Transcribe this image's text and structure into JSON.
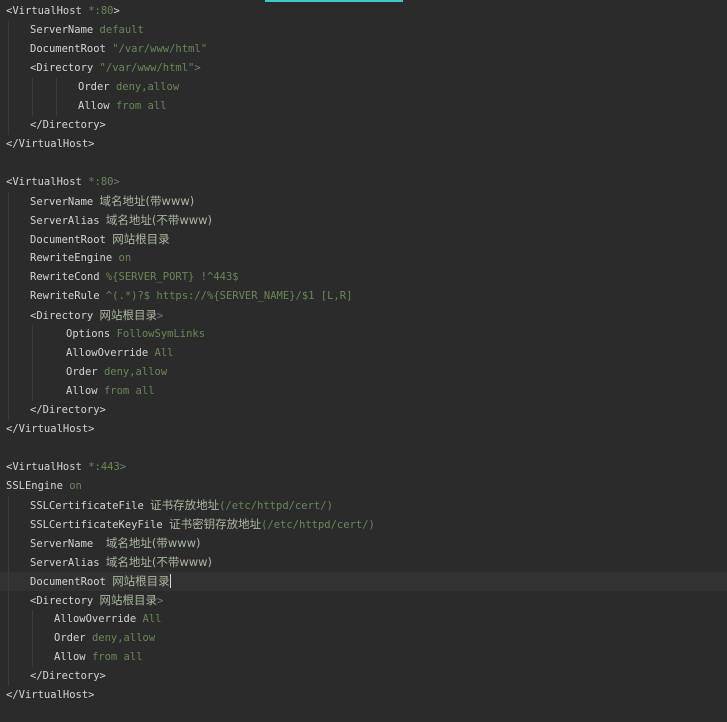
{
  "editor": {
    "lines": [
      {
        "indent": 0,
        "tokens": [
          {
            "t": "<VirtualHost ",
            "c": "k"
          },
          {
            "t": "*:80",
            "c": "v"
          },
          {
            "t": ">",
            "c": "k"
          }
        ]
      },
      {
        "indent": 1,
        "tokens": [
          {
            "t": "ServerName ",
            "c": "k"
          },
          {
            "t": "default",
            "c": "v"
          }
        ]
      },
      {
        "indent": 1,
        "tokens": [
          {
            "t": "DocumentRoot ",
            "c": "k"
          },
          {
            "t": "\"/var/www/html\"",
            "c": "v"
          }
        ]
      },
      {
        "indent": 1,
        "tokens": [
          {
            "t": "<Directory ",
            "c": "k"
          },
          {
            "t": "\"/var/www/html\"",
            "c": "v"
          },
          {
            "t": ">",
            "c": "p"
          }
        ]
      },
      {
        "indent": 3,
        "tokens": [
          {
            "t": "Order ",
            "c": "k"
          },
          {
            "t": "deny,allow",
            "c": "v"
          }
        ]
      },
      {
        "indent": 3,
        "tokens": [
          {
            "t": "Allow ",
            "c": "k"
          },
          {
            "t": "from all",
            "c": "v"
          }
        ]
      },
      {
        "indent": 1,
        "tokens": [
          {
            "t": "</Directory>",
            "c": "k"
          }
        ]
      },
      {
        "indent": 0,
        "tokens": [
          {
            "t": "</VirtualHost>",
            "c": "k"
          }
        ]
      },
      {
        "indent": 0,
        "tokens": []
      },
      {
        "indent": 0,
        "tokens": [
          {
            "t": "<VirtualHost ",
            "c": "k"
          },
          {
            "t": "*:80",
            "c": "v"
          },
          {
            "t": ">",
            "c": "p"
          }
        ]
      },
      {
        "indent": 1,
        "tokens": [
          {
            "t": "ServerName ",
            "c": "k"
          },
          {
            "t": "域名地址(带www)",
            "c": "cjk"
          }
        ]
      },
      {
        "indent": 1,
        "tokens": [
          {
            "t": "ServerAlias ",
            "c": "k"
          },
          {
            "t": "域名地址(不带www)",
            "c": "cjk"
          }
        ]
      },
      {
        "indent": 1,
        "tokens": [
          {
            "t": "DocumentRoot ",
            "c": "k"
          },
          {
            "t": "网站根目录",
            "c": "cjk"
          }
        ]
      },
      {
        "indent": 1,
        "tokens": [
          {
            "t": "RewriteEngine ",
            "c": "k"
          },
          {
            "t": "on",
            "c": "v"
          }
        ]
      },
      {
        "indent": 1,
        "tokens": [
          {
            "t": "RewriteCond ",
            "c": "k"
          },
          {
            "t": "%{SERVER_PORT} !^443$",
            "c": "v"
          }
        ]
      },
      {
        "indent": 1,
        "tokens": [
          {
            "t": "RewriteRule ",
            "c": "k"
          },
          {
            "t": "^(.*)?$ https://%{SERVER_NAME}/$1 [L,R]",
            "c": "v"
          }
        ]
      },
      {
        "indent": 1,
        "tokens": [
          {
            "t": "<Directory ",
            "c": "k"
          },
          {
            "t": "网站根目录",
            "c": "cjk"
          },
          {
            "t": ">",
            "c": "p"
          }
        ]
      },
      {
        "indent": 2.5,
        "tokens": [
          {
            "t": "Options ",
            "c": "k"
          },
          {
            "t": "FollowSymLinks",
            "c": "v"
          }
        ]
      },
      {
        "indent": 2.5,
        "tokens": [
          {
            "t": "AllowOverride ",
            "c": "k"
          },
          {
            "t": "All",
            "c": "v"
          }
        ]
      },
      {
        "indent": 2.5,
        "tokens": [
          {
            "t": "Order ",
            "c": "k"
          },
          {
            "t": "deny,allow",
            "c": "v"
          }
        ]
      },
      {
        "indent": 2.5,
        "tokens": [
          {
            "t": "Allow ",
            "c": "k"
          },
          {
            "t": "from all",
            "c": "v"
          }
        ]
      },
      {
        "indent": 1,
        "tokens": [
          {
            "t": "</Directory>",
            "c": "k"
          }
        ]
      },
      {
        "indent": 0,
        "tokens": [
          {
            "t": "</VirtualHost>",
            "c": "k"
          }
        ]
      },
      {
        "indent": 0,
        "tokens": []
      },
      {
        "indent": 0,
        "tokens": [
          {
            "t": "<VirtualHost ",
            "c": "k"
          },
          {
            "t": "*:443",
            "c": "v"
          },
          {
            "t": ">",
            "c": "p"
          }
        ]
      },
      {
        "indent": 0,
        "tokens": [
          {
            "t": "SSLEngine ",
            "c": "k"
          },
          {
            "t": "on",
            "c": "v"
          }
        ]
      },
      {
        "indent": 1,
        "tokens": [
          {
            "t": "SSLCertificateFile ",
            "c": "k"
          },
          {
            "t": "证书存放地址",
            "c": "cjk"
          },
          {
            "t": "(/etc/httpd/cert/)",
            "c": "v"
          }
        ]
      },
      {
        "indent": 1,
        "tokens": [
          {
            "t": "SSLCertificateKeyFile ",
            "c": "k"
          },
          {
            "t": "证书密钥存放地址",
            "c": "cjk"
          },
          {
            "t": "(/etc/httpd/cert/)",
            "c": "v"
          }
        ]
      },
      {
        "indent": 1,
        "tokens": [
          {
            "t": "ServerName  ",
            "c": "k"
          },
          {
            "t": "域名地址(带www)",
            "c": "cjk"
          }
        ]
      },
      {
        "indent": 1,
        "tokens": [
          {
            "t": "ServerAlias ",
            "c": "k"
          },
          {
            "t": "域名地址(不带www)",
            "c": "cjk"
          }
        ]
      },
      {
        "indent": 1,
        "current": true,
        "tokens": [
          {
            "t": "DocumentRoot ",
            "c": "k"
          },
          {
            "t": "网站根目录",
            "c": "cjk"
          }
        ]
      },
      {
        "indent": 1,
        "tokens": [
          {
            "t": "<Directory ",
            "c": "k"
          },
          {
            "t": "网站根目录",
            "c": "cjk"
          },
          {
            "t": ">",
            "c": "p"
          }
        ]
      },
      {
        "indent": 2,
        "tokens": [
          {
            "t": "AllowOverride ",
            "c": "k"
          },
          {
            "t": "All",
            "c": "v"
          }
        ]
      },
      {
        "indent": 2,
        "tokens": [
          {
            "t": "Order ",
            "c": "k"
          },
          {
            "t": "deny,allow",
            "c": "v"
          }
        ]
      },
      {
        "indent": 2,
        "tokens": [
          {
            "t": "Allow ",
            "c": "k"
          },
          {
            "t": "from all",
            "c": "v"
          }
        ]
      },
      {
        "indent": 1,
        "tokens": [
          {
            "t": "</Directory>",
            "c": "k"
          }
        ]
      },
      {
        "indent": 0,
        "tokens": [
          {
            "t": "</VirtualHost>",
            "c": "k"
          }
        ]
      }
    ]
  }
}
